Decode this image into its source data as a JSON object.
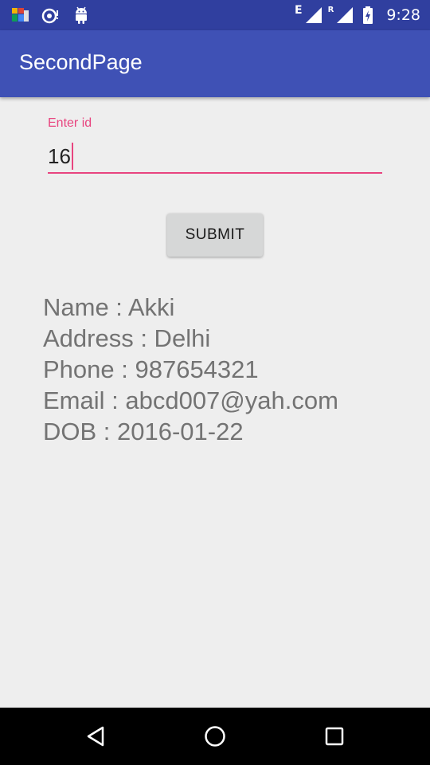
{
  "status_bar": {
    "time": "9:28",
    "network_letter": "E",
    "roaming_letter": "R",
    "icons": [
      "app-icon",
      "sync-icon",
      "android-icon",
      "signal-icon",
      "signal-roaming-icon",
      "battery-charging-icon"
    ]
  },
  "app_bar": {
    "title": "SecondPage",
    "color": "#3f51b5",
    "status_color": "#303f9f"
  },
  "form": {
    "id_field": {
      "label": "Enter id",
      "value": "16",
      "accent_color": "#e8447f"
    },
    "submit_label": "SUBMIT"
  },
  "result": {
    "lines": [
      "Name : Akki",
      "Address : Delhi",
      "Phone : 987654321",
      "Email : abcd007@yah.com",
      "DOB : 2016-01-22"
    ]
  },
  "nav_bar": {
    "icons": [
      "back-icon",
      "home-icon",
      "recents-icon"
    ]
  }
}
